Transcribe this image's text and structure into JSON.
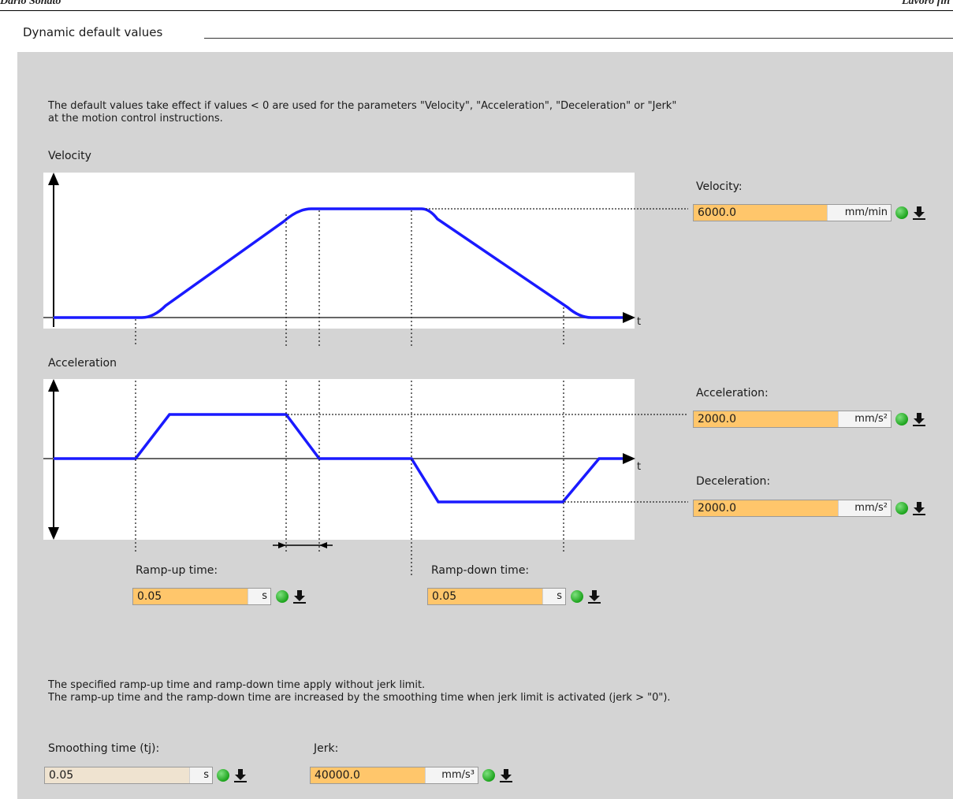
{
  "page_header": {
    "left": "Dario Sonato",
    "right": "Lavoro fin"
  },
  "section": {
    "title": "Dynamic default values"
  },
  "intro": {
    "line1": "The default values take effect if values < 0 are used for the parameters \"Velocity\", \"Acceleration\", \"Deceleration\" or \"Jerk\"",
    "line2": "at the motion control instructions."
  },
  "charts": {
    "velocity_title": "Velocity",
    "acceleration_title": "Acceleration",
    "time_axis_label": "t"
  },
  "velocity": {
    "label": "Velocity:",
    "value": "6000.0",
    "unit": "mm/min"
  },
  "acceleration": {
    "label": "Acceleration:",
    "value": "2000.0",
    "unit": "mm/s²"
  },
  "deceleration": {
    "label": "Deceleration:",
    "value": "2000.0",
    "unit": "mm/s²"
  },
  "ramp_up": {
    "label": "Ramp-up time:",
    "value": "0.05",
    "unit": "s"
  },
  "ramp_down": {
    "label": "Ramp-down time:",
    "value": "0.05",
    "unit": "s"
  },
  "note": {
    "line1": "The specified ramp-up time and ramp-down time apply without jerk limit.",
    "line2": "The ramp-up time and the ramp-down time are increased by the smoothing time when jerk limit is activated (jerk > \"0\")."
  },
  "smoothing": {
    "label": "Smoothing time (tj):",
    "value": "0.05",
    "unit": "s"
  },
  "jerk": {
    "label": "Jerk:",
    "value": "40000.0",
    "unit": "mm/s³"
  },
  "colors": {
    "field_bg": "#ffc66b",
    "panel_bg": "#d4d4d4",
    "curve": "#1a1aff",
    "status_ok": "#22aa22"
  },
  "icons": {
    "status": "green-status-dot-icon",
    "download": "download-arrow-icon"
  }
}
